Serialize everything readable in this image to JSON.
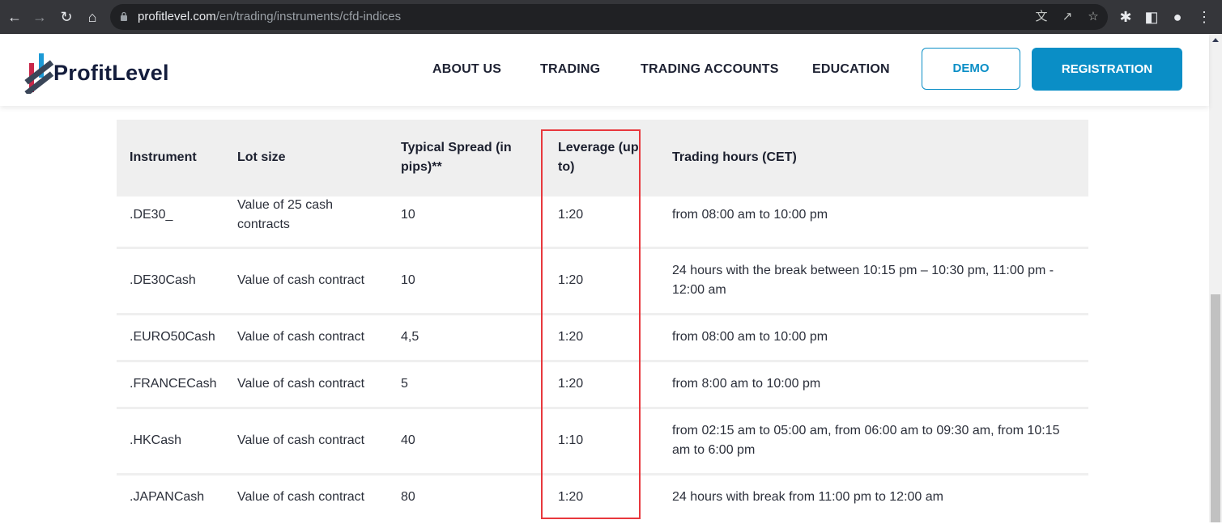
{
  "browser": {
    "url_host": "profitlevel.com",
    "url_path": "/en/trading/instruments/cfd-indices"
  },
  "header": {
    "logo_text": "ProfitLevel",
    "menu": [
      "ABOUT US",
      "TRADING",
      "TRADING ACCOUNTS",
      "EDUCATION"
    ],
    "demo_label": "DEMO",
    "registration_label": "REGISTRATION"
  },
  "colors": {
    "accent": "#0a8ec6",
    "highlight": "#e8383d",
    "header_bg": "#efefef"
  },
  "table": {
    "headers": [
      "Instrument",
      "Lot size",
      "Typical Spread (in pips)**",
      "Leverage (up to)",
      "Trading hours (CET)"
    ],
    "rows": [
      [
        ".DE30_",
        "Value of 25 cash contracts",
        "10",
        "1:20",
        "from 08:00 am to 10:00 pm"
      ],
      [
        ".DE30Cash",
        "Value of cash contract",
        "10",
        "1:20",
        "24 hours with the break between 10:15 pm – 10:30 pm, 11:00 pm - 12:00 am"
      ],
      [
        ".EURO50Cash",
        "Value of cash contract",
        "4,5",
        "1:20",
        "from 08:00 am to 10:00 pm"
      ],
      [
        ".FRANCECash",
        "Value of cash contract",
        "5",
        "1:20",
        "from 8:00 am to 10:00 pm"
      ],
      [
        ".HKCash",
        "Value of cash contract",
        "40",
        "1:10",
        "from 02:15 am to 05:00 am, from 06:00 am to 09:30 am, from 10:15 am to 6:00 pm"
      ],
      [
        ".JAPANCash",
        "Value of cash contract",
        "80",
        "1:20",
        "24 hours with break from 11:00 pm to 12:00 am"
      ]
    ]
  }
}
